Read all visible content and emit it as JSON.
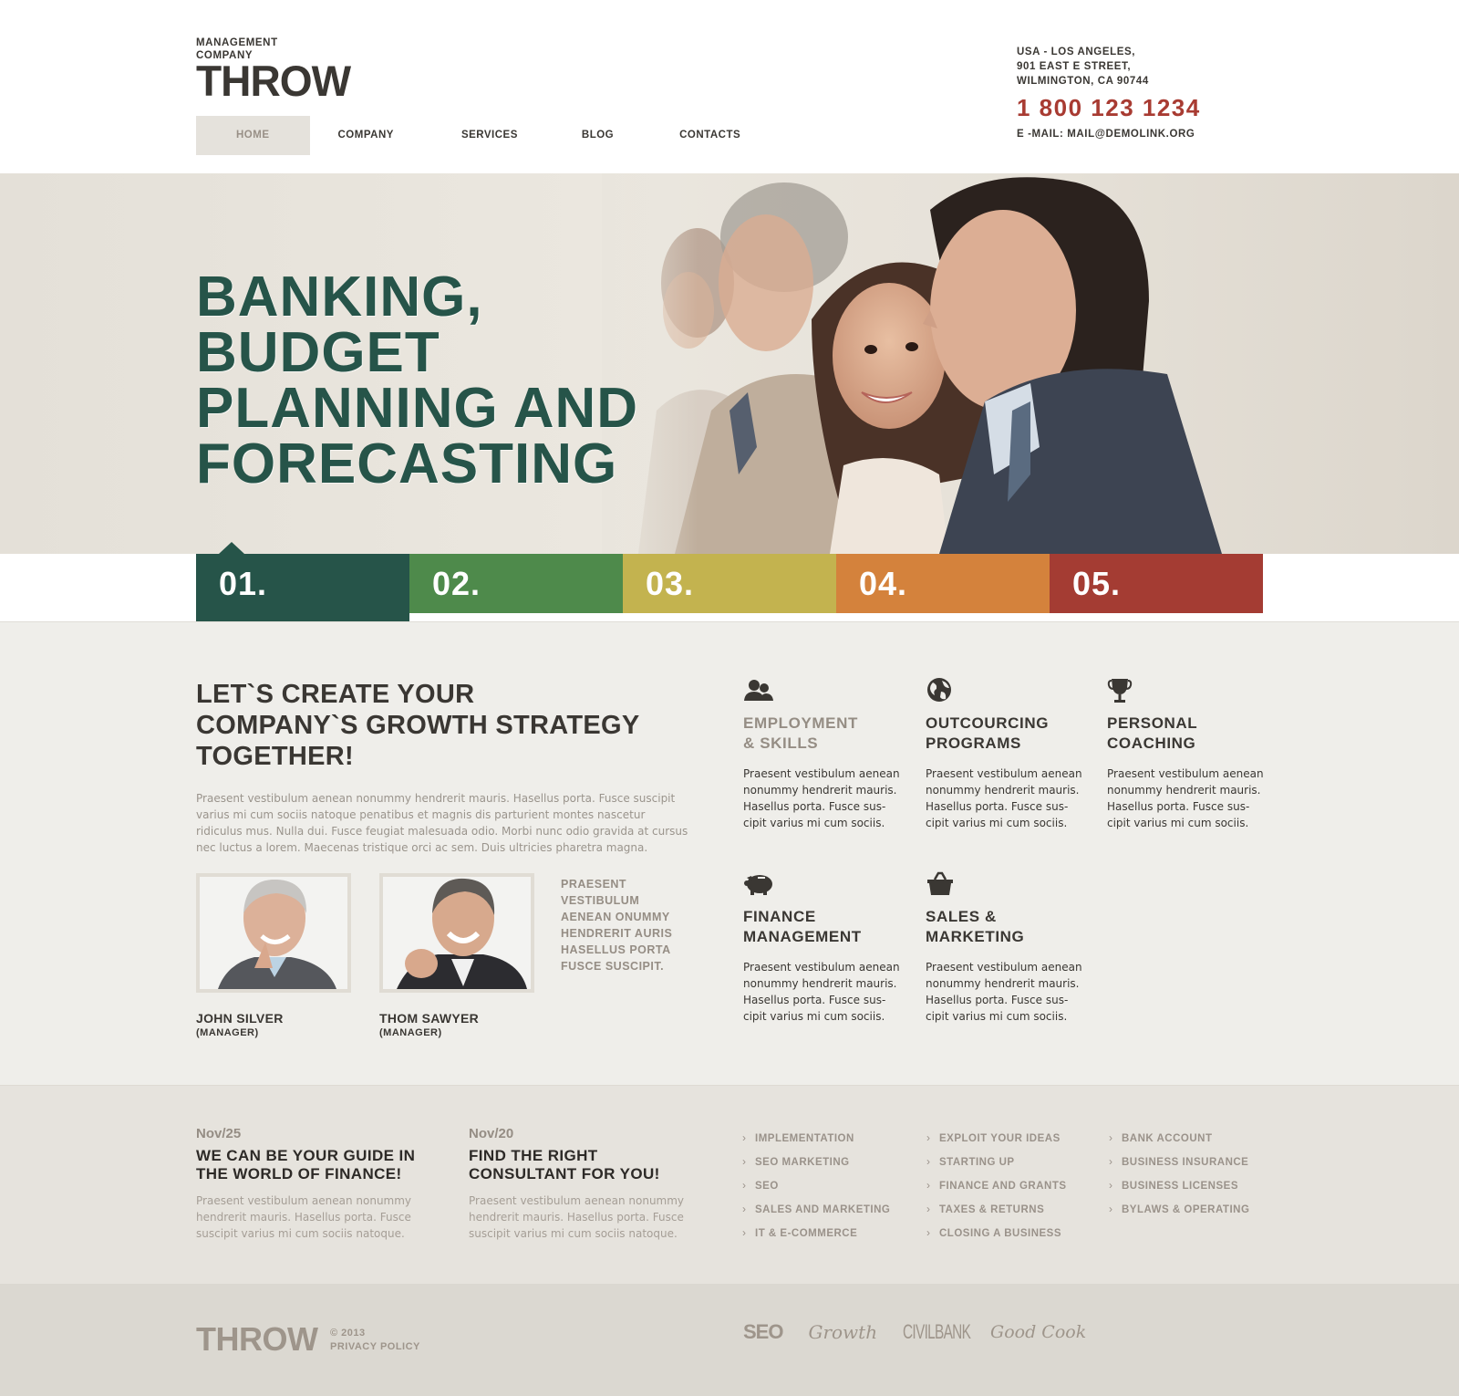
{
  "header": {
    "logo_sub": "MANAGEMENT COMPANY",
    "logo_main": "THROW",
    "nav": [
      {
        "label": "HOME",
        "active": true
      },
      {
        "label": "COMPANY",
        "active": false
      },
      {
        "label": "SERVICES",
        "active": false
      },
      {
        "label": "BLOG",
        "active": false
      },
      {
        "label": "CONTACTS",
        "active": false
      }
    ],
    "address_lines": [
      "USA - LOS ANGELES,",
      "901 EAST E STREET,",
      "WILMINGTON, CA 90744"
    ],
    "phone": "1 800 123 1234",
    "email": "E -MAIL: MAIL@DEMOLINK.ORG"
  },
  "hero": {
    "title_lines": [
      "BANKING,",
      "BUDGET",
      "PLANNING AND",
      "FORECASTING"
    ],
    "image": "business-team-photo"
  },
  "slider_tabs": [
    {
      "label": "01.",
      "color": "#265449",
      "active": true
    },
    {
      "label": "02.",
      "color": "#4e8a4b",
      "active": false
    },
    {
      "label": "03.",
      "color": "#c3b34f",
      "active": false
    },
    {
      "label": "04.",
      "color": "#d4823c",
      "active": false
    },
    {
      "label": "05.",
      "color": "#a43c33",
      "active": false
    }
  ],
  "intro": {
    "heading_lines": [
      "LET`S CREATE YOUR",
      "COMPANY`S GROWTH STRATEGY",
      "TOGETHER!"
    ],
    "body": "Praesent vestibulum aenean nonummy hendrerit mauris. Hasellus porta. Fusce suscipit varius mi cum sociis natoque penatibus et magnis dis parturient montes nascetur ridiculus mus. Nulla dui. Fusce feugiat malesuada odio. Morbi nunc odio gravida at cursus nec luctus a lorem. Maecenas tristique orci ac sem. Duis ultricies pharetra magna."
  },
  "team": [
    {
      "name": "JOHN SILVER",
      "role": "(MANAGER)"
    },
    {
      "name": "THOM SAWYER",
      "role": "(MANAGER)"
    }
  ],
  "team_quote": "PRAESENT VESTIBULUM AENEAN ONUMMY HENDRERIT AURIS HASELLUS PORTA FUSCE SUSCIPIT.",
  "services": [
    {
      "icon": "users-icon",
      "title_lines": [
        "EMPLOYMENT",
        "& SKILLS"
      ],
      "highlighted": true,
      "text": "Praesent vestibulum aenean nonummy hendrerit mauris. Hasellus porta. Fusce sus-cipit varius mi cum sociis."
    },
    {
      "icon": "globe-icon",
      "title_lines": [
        "OUTCOURCING",
        "PROGRAMS"
      ],
      "highlighted": false,
      "text": "Praesent vestibulum aenean nonummy hendrerit mauris. Hasellus porta. Fusce sus-cipit varius mi cum sociis."
    },
    {
      "icon": "trophy-icon",
      "title_lines": [
        "PERSONAL",
        "COACHING"
      ],
      "highlighted": false,
      "text": "Praesent vestibulum aenean nonummy hendrerit mauris. Hasellus porta. Fusce sus-cipit varius mi cum sociis."
    },
    {
      "icon": "piggy-bank-icon",
      "title_lines": [
        "FINANCE",
        "MANAGEMENT"
      ],
      "highlighted": false,
      "text": "Praesent vestibulum aenean nonummy hendrerit mauris. Hasellus porta. Fusce sus-cipit varius mi cum sociis."
    },
    {
      "icon": "basket-icon",
      "title_lines": [
        "SALES &",
        "MARKETING"
      ],
      "highlighted": false,
      "text": "Praesent vestibulum aenean nonummy hendrerit mauris. Hasellus porta. Fusce sus-cipit varius mi cum sociis."
    }
  ],
  "posts": [
    {
      "date": "Nov/25",
      "title_lines": [
        "WE CAN BE YOUR GUIDE IN",
        "THE WORLD OF FINANCE!"
      ],
      "text": "Praesent vestibulum aenean nonummy hendrerit mauris. Hasellus porta. Fusce suscipit varius mi cum sociis natoque."
    },
    {
      "date": "Nov/20",
      "title_lines": [
        "FIND THE RIGHT",
        "CONSULTANT FOR YOU!"
      ],
      "text": "Praesent vestibulum aenean nonummy hendrerit mauris. Hasellus porta. Fusce suscipit varius mi cum sociis natoque."
    }
  ],
  "link_columns": [
    [
      "IMPLEMENTATION",
      "SEO MARKETING",
      "SEO",
      "SALES AND MARKETING",
      "IT & E-COMMERCE"
    ],
    [
      "EXPLOIT YOUR IDEAS",
      "STARTING UP",
      "FINANCE AND GRANTS",
      "TAXES & RETURNS",
      "CLOSING A BUSINESS"
    ],
    [
      "BANK ACCOUNT",
      "BUSINESS INSURANCE",
      "BUSINESS LICENSES",
      "BYLAWS & OPERATING"
    ]
  ],
  "footer": {
    "logo": "THROW",
    "copyright": "© 2013",
    "privacy": "PRIVACY POLICY",
    "partners": [
      "SEO",
      "Growth",
      "CIVILBANK",
      "Good Cook"
    ]
  }
}
